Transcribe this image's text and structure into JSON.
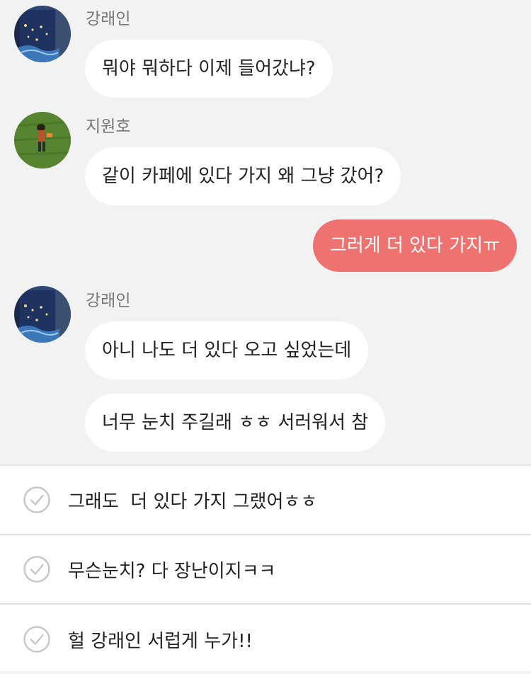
{
  "messages": [
    {
      "sender": "강래인",
      "avatar": "night-window-avatar",
      "text": "뭐야 뭐하다 이제 들어갔냐?"
    },
    {
      "sender": "지원호",
      "avatar": "grass-lying-avatar",
      "text": "같이 카페에 있다 가지 왜 그냥 갔어?"
    },
    {
      "mine": true,
      "text": "그러게 더 있다 가지ㅠ"
    },
    {
      "sender": "강래인",
      "avatar": "night-window-avatar",
      "text": "아니 나도 더 있다 오고 싶었는데"
    },
    {
      "text": "너무 눈치 주길래 ㅎㅎ 서러워서 참"
    }
  ],
  "replies": [
    {
      "text": "그래도  더 있다 가지 그랬어ㅎㅎ",
      "icon": "check-circle-icon"
    },
    {
      "text": "무슨눈치? 다 장난이지ㅋㅋ",
      "icon": "check-circle-icon"
    },
    {
      "text": "헐 강래인 서럽게 누가!!",
      "icon": "check-circle-icon"
    }
  ],
  "colors": {
    "background": "#f2f2f2",
    "bubble": "#ffffff",
    "mine_bubble": "#ee7370",
    "text": "#222222",
    "sender": "#777777",
    "divider": "#e2e2e2"
  }
}
